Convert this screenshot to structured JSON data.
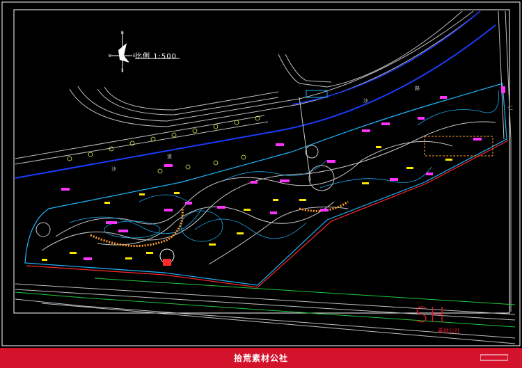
{
  "drawing": {
    "scale_label": "比例 1:500",
    "north_letters": [
      "N",
      "W",
      "E",
      "S"
    ],
    "road_labels": [
      "路",
      "道",
      "沙",
      "沙",
      "仁"
    ]
  },
  "watermark": {
    "logo": "SH",
    "subtitle": "素材公社"
  },
  "footer": {
    "text": "拾荒素材公社"
  },
  "colors": {
    "background": "#000000",
    "border": "#ffffff",
    "road": "#bfbfbf",
    "canal": "#1a3cff",
    "contour": "#1fb7ff",
    "path": "#c9c9c9",
    "label": "#ff33ff",
    "annotation": "#ffe600",
    "tree": "#e6f05a",
    "boundary": "#ff2a2a",
    "greenline": "#22c93a",
    "brand_red": "#d3122c"
  }
}
